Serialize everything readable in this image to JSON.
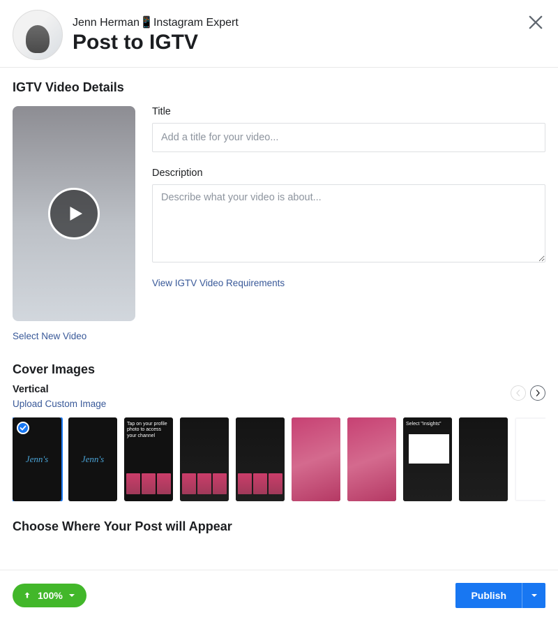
{
  "header": {
    "user_name": "Jenn Herman📱Instagram Expert",
    "title": "Post to IGTV",
    "close_label": "Close"
  },
  "details": {
    "section_title": "IGTV Video Details",
    "select_new_label": "Select New Video",
    "title_label": "Title",
    "title_placeholder": "Add a title for your video...",
    "title_value": "",
    "desc_label": "Description",
    "desc_placeholder": "Describe what your video is about...",
    "desc_value": "",
    "requirements_link": "View IGTV Video Requirements"
  },
  "cover": {
    "section_title": "Cover Images",
    "orientation": "Vertical",
    "upload_link": "Upload Custom Image",
    "thumbs": [
      {
        "selected": true,
        "kind": "logo",
        "text": "Jenn's"
      },
      {
        "selected": false,
        "kind": "logo",
        "text": "Jenn's"
      },
      {
        "selected": false,
        "kind": "caption",
        "text": "Tap on your profile photo to access your channel"
      },
      {
        "selected": false,
        "kind": "app"
      },
      {
        "selected": false,
        "kind": "app"
      },
      {
        "selected": false,
        "kind": "portrait"
      },
      {
        "selected": false,
        "kind": "portrait"
      },
      {
        "selected": false,
        "kind": "panel",
        "text": "Select \"Insights\""
      },
      {
        "selected": false,
        "kind": "dark"
      },
      {
        "selected": false,
        "kind": "light"
      }
    ]
  },
  "appear": {
    "section_title": "Choose Where Your Post will Appear"
  },
  "footer": {
    "upload_percent": "100%",
    "publish_label": "Publish"
  }
}
